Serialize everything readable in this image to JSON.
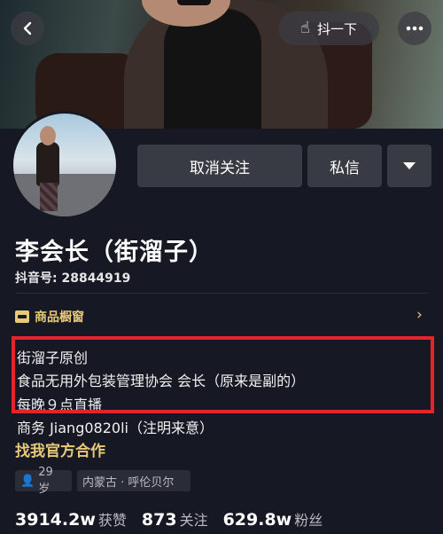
{
  "header": {
    "back_icon": "chevron-left-icon",
    "shake_label": "抖一下",
    "shake_icon": "hand-tap-icon",
    "more_icon": "ellipsis-icon"
  },
  "actions": {
    "unfollow_label": "取消关注",
    "message_label": "私信",
    "more_icon": "triangle-down-icon"
  },
  "profile": {
    "name": "李会长（街溜子）",
    "douyin_id": "抖音号: 28844919"
  },
  "shop": {
    "label": "商品橱窗",
    "icon": "storefront-icon",
    "chevron": "›"
  },
  "bio": {
    "lines": [
      "街溜子原创",
      "食品无用外包装管理协会 会长（原来是副的）",
      "每晚９点直播",
      "商务 Jiang0820li（注明来意）"
    ],
    "highlight_color": "#e3242b"
  },
  "official_link": "找我官方合作",
  "tags": {
    "age": "29 岁",
    "location": "内蒙古 · 呼伦贝尔"
  },
  "stats": {
    "likes_value": "3914.2w",
    "likes_label": "获赞",
    "following_value": "873",
    "following_label": "关注",
    "followers_value": "629.8w",
    "followers_label": "粉丝"
  },
  "colors": {
    "background": "#161823",
    "accent_gold": "#e8c97a",
    "button_bg": "#393b44"
  }
}
